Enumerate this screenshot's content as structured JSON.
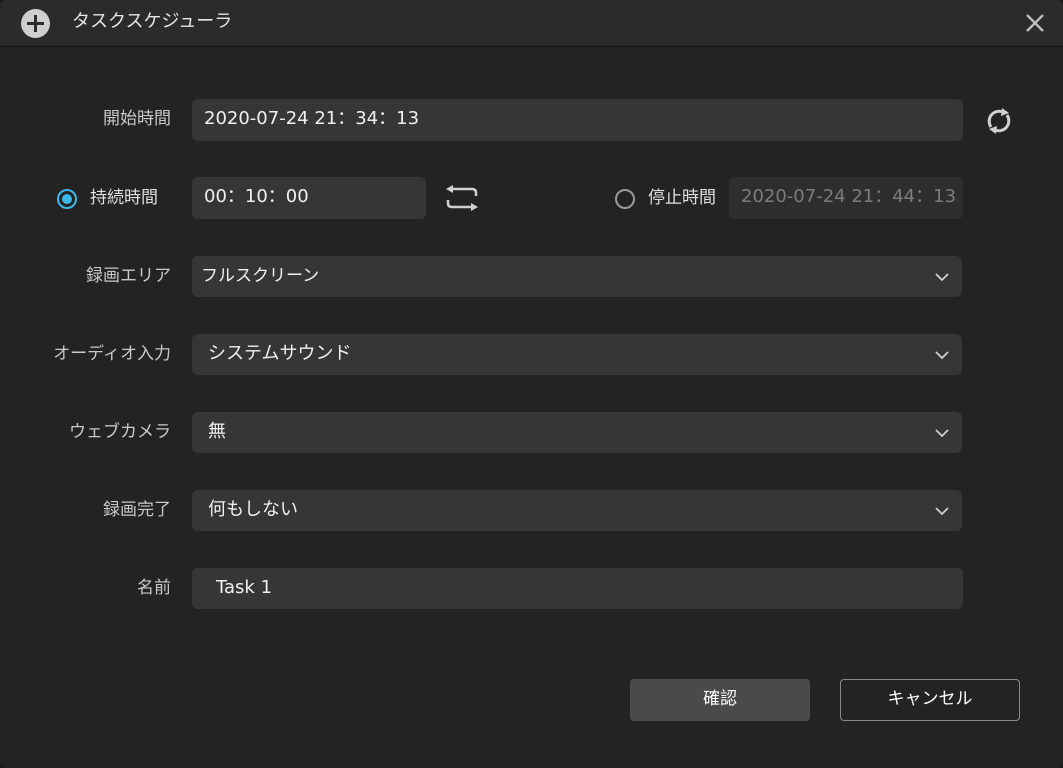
{
  "window": {
    "title": "タスクスケジューラ"
  },
  "form": {
    "start_time": {
      "label": "開始時間",
      "value": "2020-07-24 21：34：13"
    },
    "duration": {
      "label": "持続時間",
      "value": "00：10：00",
      "selected": true
    },
    "stop_time": {
      "label": "停止時間",
      "value": "2020-07-24 21：44：13",
      "selected": false
    },
    "record_area": {
      "label": "録画エリア",
      "value": "フルスクリーン"
    },
    "audio_input": {
      "label": "オーディオ入力",
      "value": "システムサウンド"
    },
    "webcam": {
      "label": "ウェブカメラ",
      "value": "無"
    },
    "on_complete": {
      "label": "録画完了",
      "value": "何もしない"
    },
    "name": {
      "label": "名前",
      "value": "Task 1"
    }
  },
  "buttons": {
    "confirm": "確認",
    "cancel": "キャンセル"
  },
  "colors": {
    "accent": "#3fb6e8",
    "background": "#232323",
    "field": "#363636"
  },
  "icons": {
    "title": "add-circle-icon",
    "close": "close-icon",
    "refresh": "refresh-icon",
    "swap": "swap-icon",
    "dropdown": "chevron-down-icon"
  }
}
